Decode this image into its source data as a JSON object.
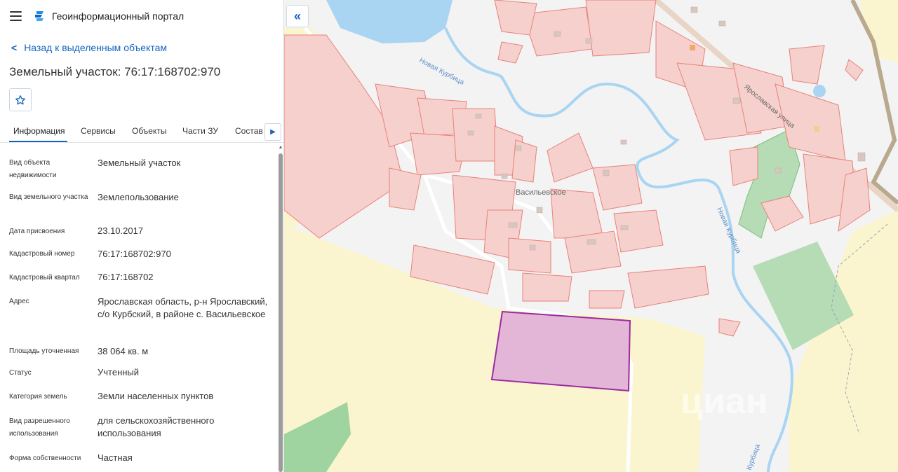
{
  "header": {
    "portal_title": "Геоинформационный портал",
    "menu_icon": "hamburger-menu-icon",
    "logo_icon": "portal-logo-icon"
  },
  "back_link": {
    "label": "Назад к выделенным объектам",
    "icon": "chevron-left-icon"
  },
  "object": {
    "title": "Земельный участок: 76:17:168702:970"
  },
  "tabs": [
    {
      "label": "Информация",
      "active": true
    },
    {
      "label": "Сервисы",
      "active": false
    },
    {
      "label": "Объекты",
      "active": false
    },
    {
      "label": "Части ЗУ",
      "active": false
    },
    {
      "label": "Состав",
      "active": false
    }
  ],
  "properties": [
    {
      "label": "Вид объекта недвижимости",
      "value": "Земельный участок"
    },
    {
      "label": "Вид земельного участка",
      "value": "Землепользование"
    },
    {
      "label": "Дата присвоения",
      "value": "23.10.2017"
    },
    {
      "label": "Кадастровый номер",
      "value": "76:17:168702:970"
    },
    {
      "label": "Кадастровый квартал",
      "value": "76:17:168702"
    },
    {
      "label": "Адрес",
      "value": "Ярославская область, р-н Ярославский, с/о Курбский, в районе с. Васильевское"
    },
    {
      "label": "Площадь уточненная",
      "value": "38 064 кв. м"
    },
    {
      "label": "Статус",
      "value": "Учтенный"
    },
    {
      "label": "Категория земель",
      "value": "Земли населенных пунктов"
    },
    {
      "label": "Вид разрешенного использования",
      "value": "для сельскохозяйственного использования"
    },
    {
      "label": "Форма собственности",
      "value": "Частная"
    }
  ],
  "map": {
    "labels": {
      "village": "Васильевское",
      "river1": "Новая Курбица",
      "river2": "Новая Курбица",
      "river3": "Курбица",
      "street": "Ярославская улица",
      "watermark": "циан"
    },
    "colors": {
      "parcel_fill": "#f6d0cd",
      "parcel_stroke": "#e8827a",
      "selected_fill": "#e3b6d8",
      "selected_stroke": "#9c2aa0",
      "field": "#fbf5cf",
      "green": "#b5dcb5",
      "water": "#a9d4f2",
      "accent": "#1565c0"
    }
  }
}
